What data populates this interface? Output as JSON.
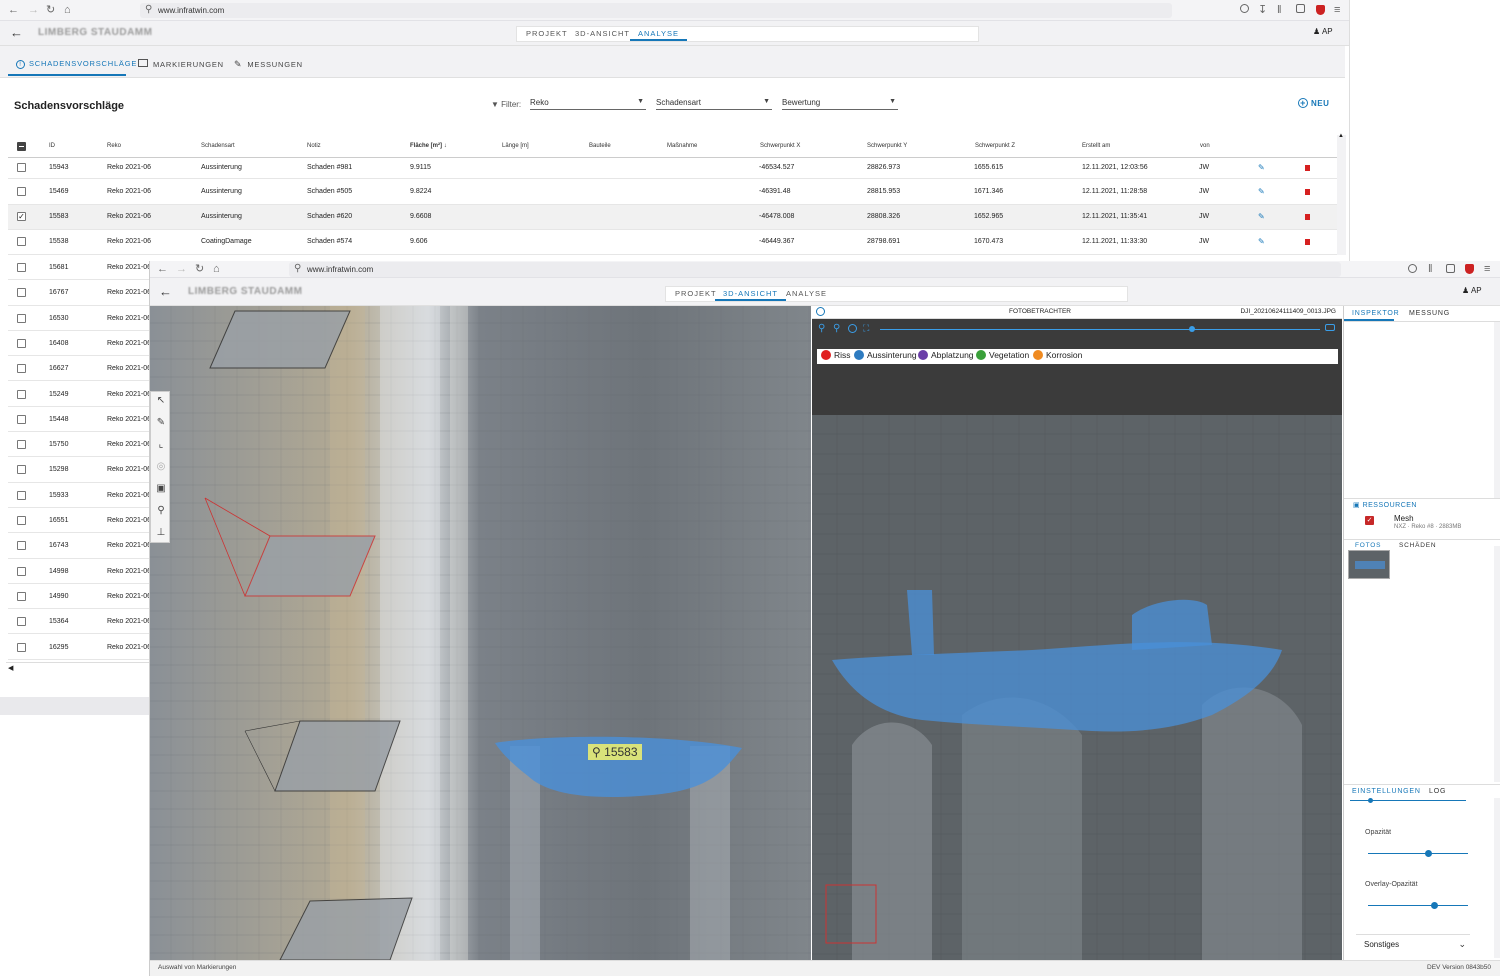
{
  "win1": {
    "url": "www.infratwin.com",
    "brand": "LIMBERG STAUDAMM",
    "tabs": [
      "PROJEKT",
      "3D-ANSICHT",
      "ANALYSE"
    ],
    "user": "AP",
    "subtabs": [
      "SCHADENSVORSCHLÄGE",
      "MARKIERUNGEN",
      "MESSUNGEN"
    ],
    "title": "Schadensvorschläge",
    "filter_label": "Filter:",
    "filters": [
      "Reko",
      "Schadensart",
      "Bewertung"
    ],
    "new_label": "NEU",
    "columns": [
      "ID",
      "Reko",
      "Schadensart",
      "Notiz",
      "Fläche [m²]",
      "Länge [m]",
      "Bauteile",
      "Maßnahme",
      "Schwerpunkt X",
      "Schwerpunkt Y",
      "Schwerpunkt Z",
      "Erstellt am",
      "von"
    ],
    "rows": [
      {
        "id": "15943",
        "reko": "Reko 2021-06",
        "art": "Aussinterung",
        "notiz": "Schaden #981",
        "flaeche": "9.9115",
        "x": "-46534.527",
        "y": "28826.973",
        "z": "1655.615",
        "date": "12.11.2021, 12:03:56",
        "von": "JW"
      },
      {
        "id": "15469",
        "reko": "Reko 2021-06",
        "art": "Aussinterung",
        "notiz": "Schaden #505",
        "flaeche": "9.8224",
        "x": "-46391.48",
        "y": "28815.953",
        "z": "1671.346",
        "date": "12.11.2021, 11:28:58",
        "von": "JW"
      },
      {
        "id": "15583",
        "reko": "Reko 2021-06",
        "art": "Aussinterung",
        "notiz": "Schaden #620",
        "flaeche": "9.6608",
        "x": "-46478.008",
        "y": "28808.326",
        "z": "1652.965",
        "date": "12.11.2021, 11:35:41",
        "von": "JW",
        "checked": true
      },
      {
        "id": "15538",
        "reko": "Reko 2021-06",
        "art": "CoatingDamage",
        "notiz": "Schaden #574",
        "flaeche": "9.606",
        "x": "-46449.367",
        "y": "28798.691",
        "z": "1670.473",
        "date": "12.11.2021, 11:33:30",
        "von": "JW"
      }
    ],
    "partial_rows": [
      {
        "id": "15681",
        "reko": "Reko 2021-06"
      },
      {
        "id": "16767",
        "reko": "Reko 2021-06"
      },
      {
        "id": "16530",
        "reko": "Reko 2021-06"
      },
      {
        "id": "16408",
        "reko": "Reko 2021-06"
      },
      {
        "id": "16627",
        "reko": "Reko 2021-06"
      },
      {
        "id": "15249",
        "reko": "Reko 2021-06"
      },
      {
        "id": "15448",
        "reko": "Reko 2021-06"
      },
      {
        "id": "15750",
        "reko": "Reko 2021-06"
      },
      {
        "id": "15298",
        "reko": "Reko 2021-06"
      },
      {
        "id": "15933",
        "reko": "Reko 2021-06"
      },
      {
        "id": "16551",
        "reko": "Reko 2021-06"
      },
      {
        "id": "16743",
        "reko": "Reko 2021-06"
      },
      {
        "id": "14998",
        "reko": "Reko 2021-06"
      },
      {
        "id": "14990",
        "reko": "Reko 2021-06"
      },
      {
        "id": "15364",
        "reko": "Reko 2021-06"
      },
      {
        "id": "16295",
        "reko": "Reko 2021-06"
      }
    ]
  },
  "win2": {
    "url": "www.infratwin.com",
    "brand": "LIMBERG STAUDAMM",
    "tabs": [
      "PROJEKT",
      "3D-ANSICHT",
      "ANALYSE"
    ],
    "user": "AP",
    "marker_label": "15583",
    "photo_title": "FOTOBETRACHTER",
    "photo_file": "DJI_20210624111409_0013.JPG",
    "legend": [
      {
        "name": "Riss",
        "color": "#e02020"
      },
      {
        "name": "Aussinterung",
        "color": "#2e7bc0"
      },
      {
        "name": "Abplatzung",
        "color": "#6a3ea8"
      },
      {
        "name": "Vegetation",
        "color": "#3aa03a"
      },
      {
        "name": "Korrosion",
        "color": "#ef8a20"
      }
    ],
    "panel_tabs": [
      "INSPEKTOR",
      "MESSUNG"
    ],
    "resources_title": "RESSOURCEN",
    "resource_name": "Mesh",
    "resource_meta": "NXZ · Reko #8 · 2883MB",
    "photo_tabs": [
      "FOTOS",
      "SCHÄDEN"
    ],
    "settings_tabs": [
      "EINSTELLUNGEN",
      "LOG"
    ],
    "slider1_label": "Opazität",
    "slider1_value": 0.6,
    "slider2_label": "Overlay-Opazität",
    "slider2_value": 0.66,
    "photo_slider_value": 0.71,
    "other_label": "Sonstiges",
    "status_left": "Auswahl von Markierungen",
    "status_right": "DEV Version 0843b50"
  },
  "colors": {
    "accent": "#1677b8",
    "delete": "#d62020",
    "overlay": "#4a90d9"
  }
}
